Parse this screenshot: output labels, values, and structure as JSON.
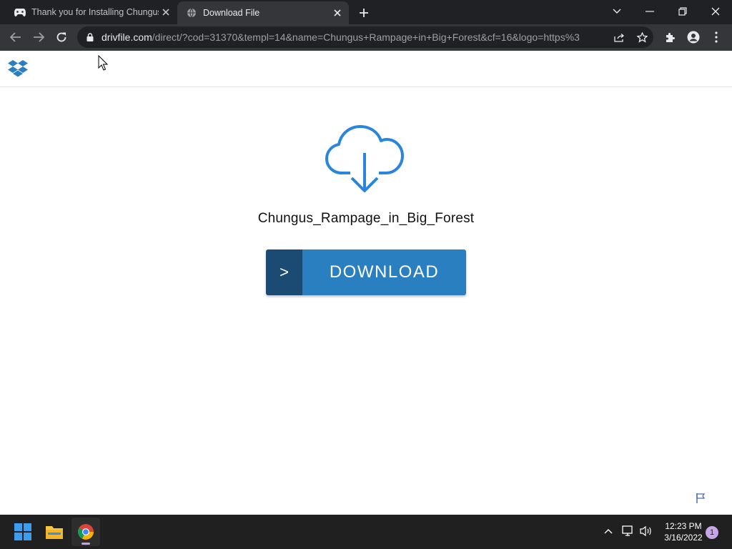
{
  "browser": {
    "tabs": [
      {
        "title": "Thank you for Installing Chungus",
        "favicon": "gamepad-icon",
        "active": false
      },
      {
        "title": "Download File",
        "favicon": "globe-icon",
        "active": true
      }
    ],
    "url_host": "drivfile.com",
    "url_path": "/direct/?cod=31370&templ=14&name=Chungus+Rampage+in+Big+Forest&cf=16&logo=https%3..."
  },
  "page": {
    "logo": "dropbox-logo",
    "file_name": "Chungus_Rampage_in_Big_Forest",
    "download_arrow": ">",
    "download_label": "DOWNLOAD",
    "accent_color": "#2a7fc0",
    "accent_dark": "#1b4a73"
  },
  "taskbar": {
    "apps": [
      "start-icon",
      "file-explorer-icon",
      "chrome-icon"
    ],
    "time": "12:23 PM",
    "date": "3/16/2022",
    "notification_count": "1"
  }
}
